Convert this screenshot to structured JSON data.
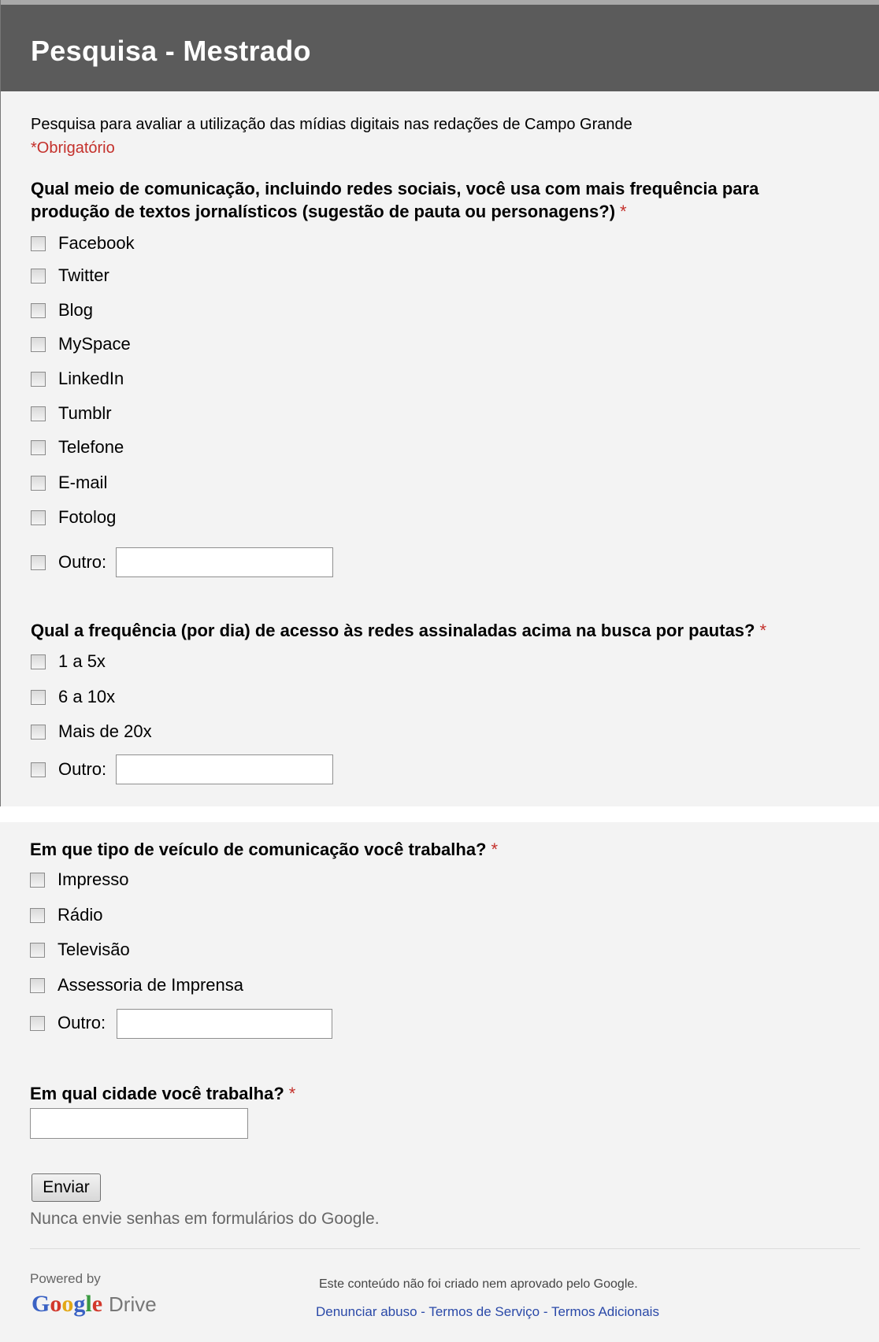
{
  "form": {
    "title": "Pesquisa - Mestrado",
    "description": "Pesquisa para avaliar a utilização das mídias digitais nas redações de Campo Grande",
    "required_note": "*Obrigatório"
  },
  "q1": {
    "line1": "Qual meio de comunicação, incluindo redes sociais, você usa com mais frequência para",
    "line2": "produção de textos jornalísticos (sugestão de pauta ou personagens?)",
    "star": "*",
    "options": [
      "Facebook",
      "Twitter",
      "Blog",
      "MySpace",
      "LinkedIn",
      "Tumblr",
      "Telefone",
      "E-mail",
      "Fotolog",
      "Outro:"
    ]
  },
  "q2": {
    "label": "Qual a frequência (por dia) de acesso às redes assinaladas acima na busca por pautas?",
    "star": "*",
    "options": [
      "1 a 5x",
      "6 a 10x",
      "Mais de 20x",
      "Outro:"
    ]
  },
  "q3": {
    "label": "Em que tipo de veículo de comunicação você trabalha?",
    "star": "*",
    "options": [
      "Impresso",
      "Rádio",
      "Televisão",
      "Assessoria de Imprensa",
      "Outro:"
    ]
  },
  "q4": {
    "label": "Em qual cidade você trabalha?",
    "star": "*",
    "value": ""
  },
  "submit_label": "Enviar",
  "warning": "Nunca envie senhas em formulários do Google.",
  "footer": {
    "powered_by": "Powered by",
    "logo": [
      "G",
      "o",
      "o",
      "g",
      "l",
      "e"
    ],
    "drive": "Drive",
    "note": "Este conteúdo não foi criado nem aprovado pelo Google.",
    "links": [
      "Denunciar abuso",
      "Termos de Serviço",
      "Termos Adicionais"
    ],
    "separator": " - "
  }
}
